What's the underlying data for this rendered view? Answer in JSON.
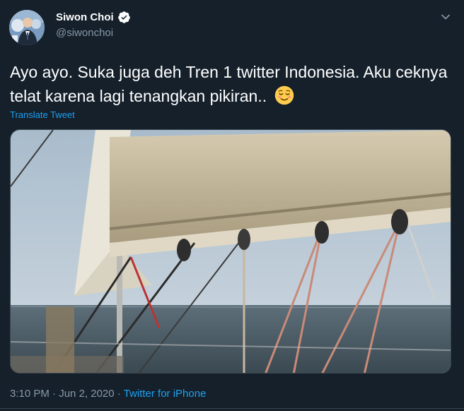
{
  "user": {
    "display_name": "Siwon Choi",
    "handle": "@siwonchoi",
    "verified": true,
    "verified_color": "#1da1f2"
  },
  "tweet": {
    "text": "Ayo ayo. Suka juga deh Tren 1 twitter Indonesia. Aku ceknya telat karena lagi tenangkan pikiran..",
    "emoji": "relieved-face-emoji",
    "translate_label": "Translate Tweet",
    "time": "3:10 PM",
    "separator1": " · ",
    "date": "Jun 2, 2020",
    "separator2": " · ",
    "source": "Twitter for iPhone"
  },
  "media": {
    "description_icon": "sailboat-photo"
  },
  "colors": {
    "background": "#15202b",
    "text": "#ffffff",
    "secondary": "#8899a6",
    "accent": "#1da1f2",
    "border": "#38444d"
  }
}
